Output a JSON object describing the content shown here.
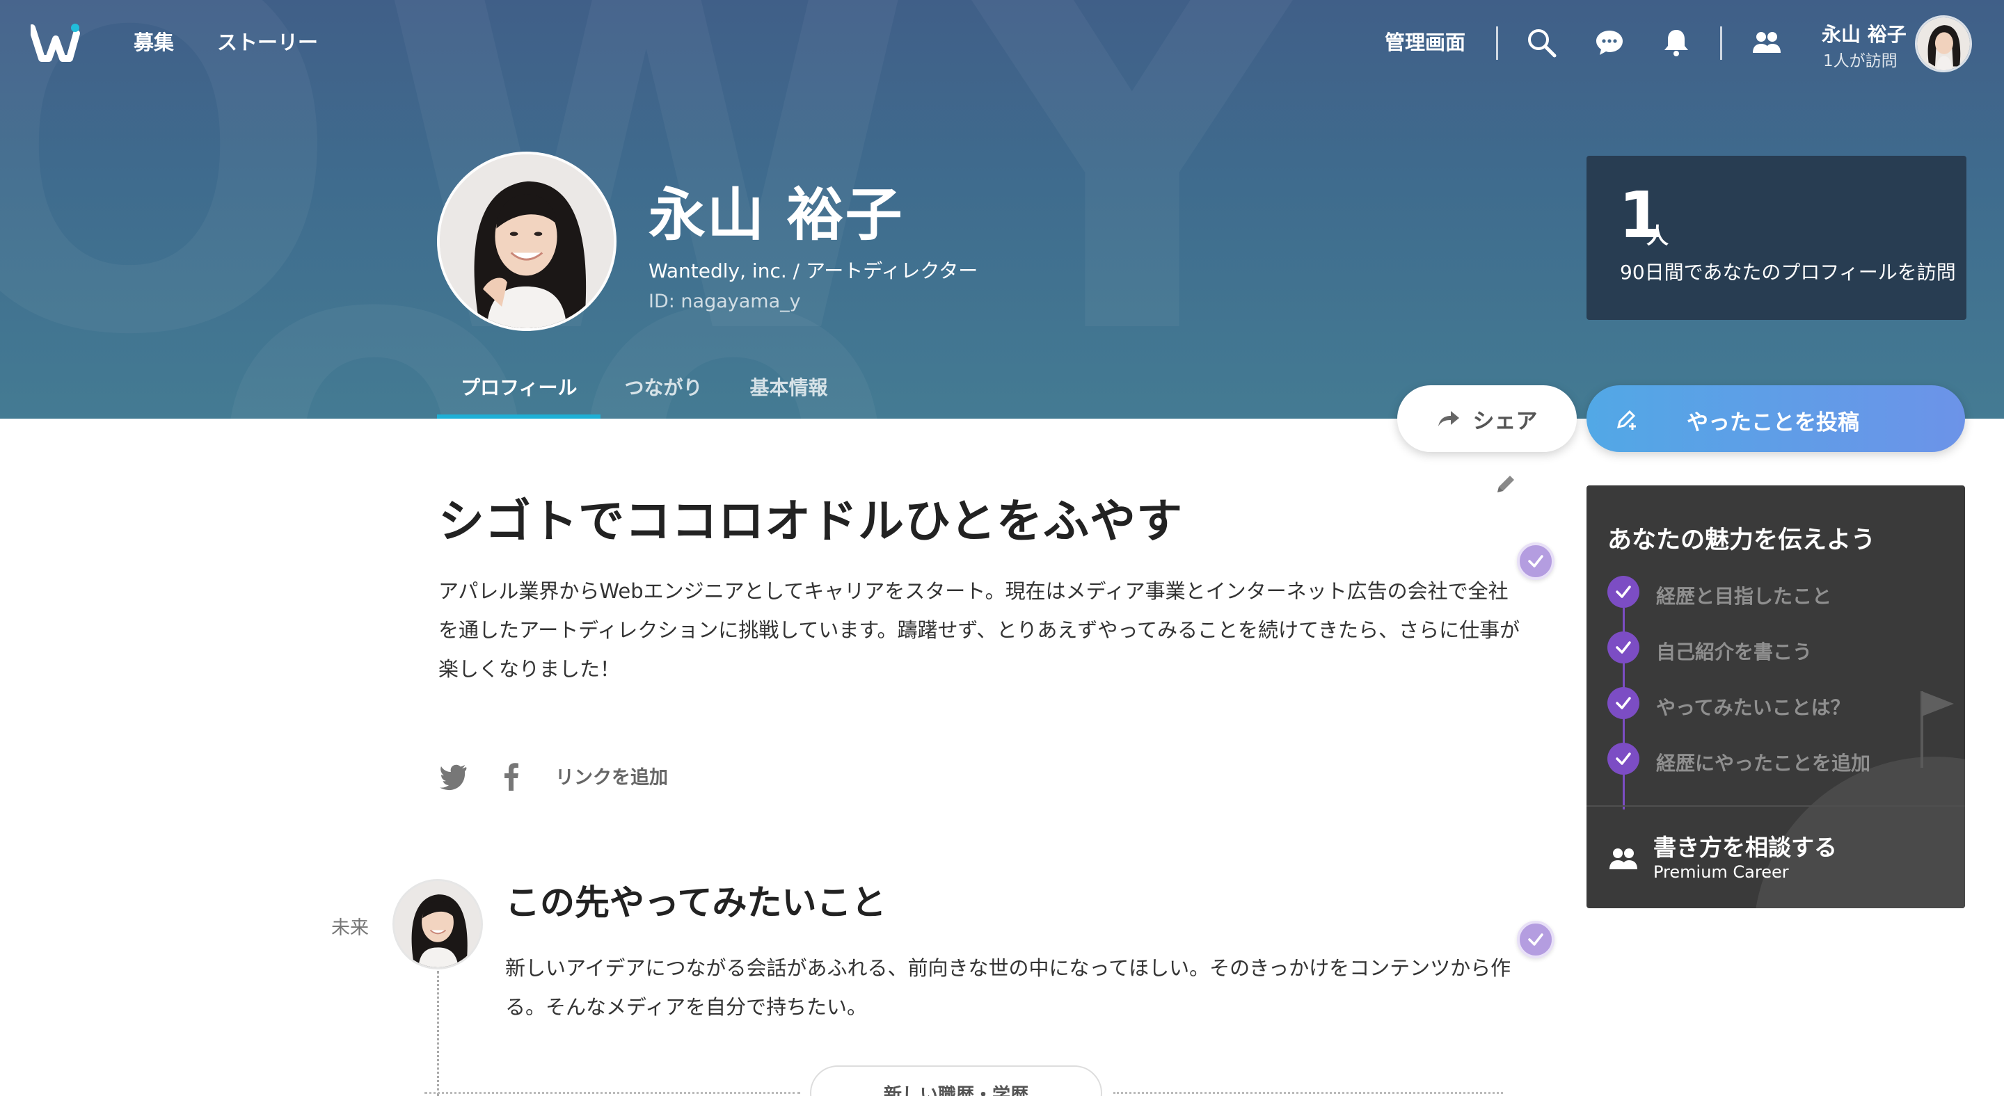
{
  "header": {
    "nav": [
      "募集",
      "ストーリー"
    ],
    "admin_label": "管理画面",
    "user_name": "永山 裕子",
    "user_visits": "1人が訪問"
  },
  "profile": {
    "name": "永山 裕子",
    "role": "Wantedly, inc. / アートディレクター",
    "id": "ID: nagayama_y",
    "tabs": [
      {
        "label": "プロフィール",
        "active": true
      },
      {
        "label": "つながり",
        "active": false
      },
      {
        "label": "基本情報",
        "active": false
      }
    ]
  },
  "visitors": {
    "count": "1",
    "unit": "人",
    "description": "90日間であなたのプロフィールを訪問"
  },
  "actions": {
    "share_label": "シェア",
    "post_label": "やったことを投稿"
  },
  "intro": {
    "headline": "シゴトでココロオドルひとをふやす",
    "body": "アパレル業界からWebエンジニアとしてキャリアをスタート。現在はメディア事業とインターネット広告の会社で全社を通したアートディレクションに挑戦しています。躊躇せず、とりあえずやってみることを続けてきたら、さらに仕事が楽しくなりました！",
    "add_link_label": "リンクを追加"
  },
  "future": {
    "label": "未来",
    "title": "この先やってみたいこと",
    "body": "新しいアイデアにつながる会話があふれる、前向きな世の中になってほしい。そのきっかけをコンテンツから作る。そんなメディアを自分で持ちたい。",
    "new_career_label": "新しい職歴・学歴"
  },
  "tips": {
    "title": "あなたの魅力を伝えよう",
    "items": [
      "経歴と目指したこと",
      "自己紹介を書こう",
      "やってみたいことは？",
      "経歴にやったことを追加"
    ],
    "consult_title": "書き方を相談する",
    "consult_sub": "Premium Career"
  },
  "colors": {
    "hero_bg": "#41668b",
    "tab_active_underline": "#1eb0d6",
    "visitor_card_bg": "#283d52",
    "post_button": "#5aa0e8",
    "check_purple": "#7c4dc4",
    "tips_card_bg": "#3a3a3a"
  }
}
